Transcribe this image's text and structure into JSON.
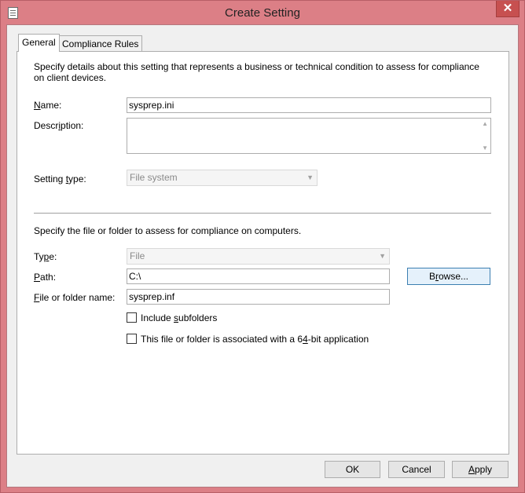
{
  "window": {
    "title": "Create Setting",
    "close_label": "✕"
  },
  "tabs": [
    {
      "label": "General",
      "selected": true
    },
    {
      "label": "Compliance Rules",
      "selected": false
    }
  ],
  "general": {
    "intro": "Specify details about this setting that represents a business or technical condition to assess for compliance on client devices.",
    "name_label": "Name:",
    "name_value": "sysprep.ini",
    "description_label": "Description:",
    "description_value": "",
    "setting_type_label": "Setting type:",
    "setting_type_value": "File system",
    "file_intro": "Specify the file or folder to assess for compliance on computers.",
    "type_label": "Type:",
    "type_value": "File",
    "path_label": "Path:",
    "path_value": "C:\\",
    "browse_label": "Browse...",
    "file_name_label": "File or folder name:",
    "file_name_value": "sysprep.inf",
    "include_subfolders_label": "Include subfolders",
    "include_subfolders_checked": false,
    "is64_label": "This file or folder is associated with a 64-bit application",
    "is64_checked": false
  },
  "buttons": {
    "ok": "OK",
    "cancel": "Cancel",
    "apply": "Apply"
  }
}
